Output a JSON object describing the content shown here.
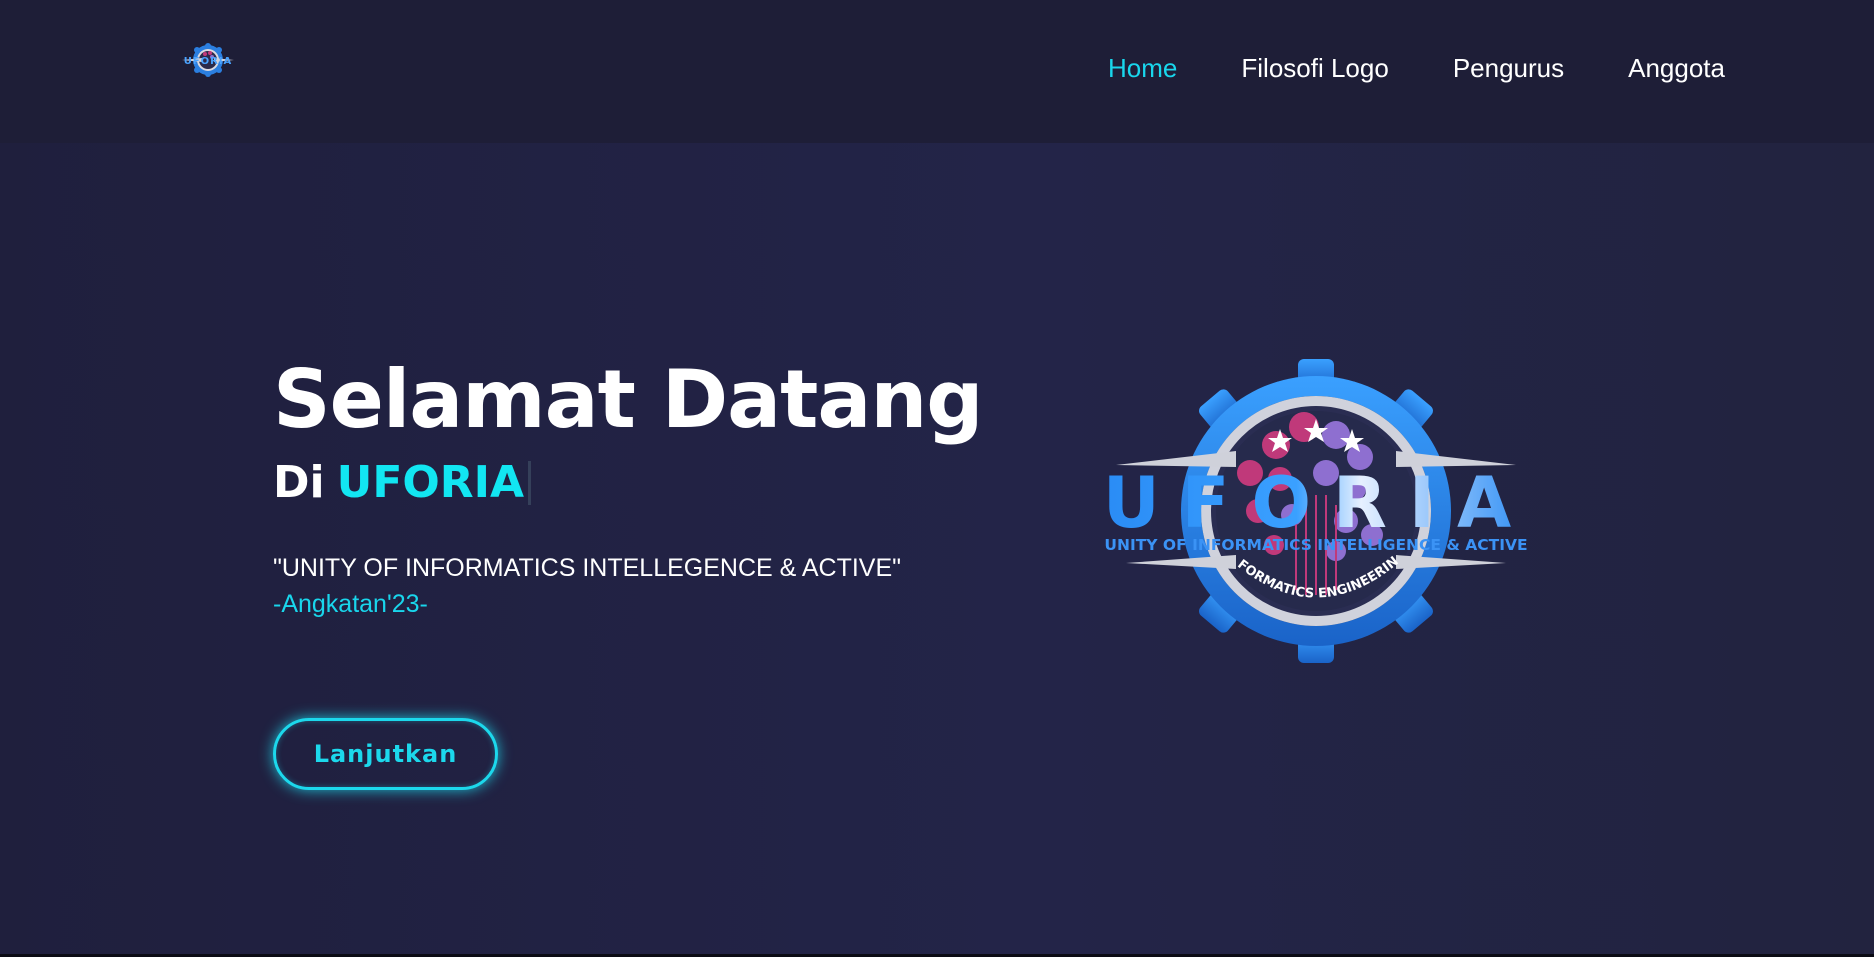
{
  "header": {
    "logo_text": "UFORIA",
    "nav": [
      {
        "label": "Home",
        "active": true
      },
      {
        "label": "Filosofi Logo",
        "active": false
      },
      {
        "label": "Pengurus",
        "active": false
      },
      {
        "label": "Anggota",
        "active": false
      }
    ]
  },
  "hero": {
    "title": "Selamat Datang",
    "sub_prefix": "Di",
    "sub_name": "UFORIA",
    "motto": "\"UNITY OF INFORMATICS INTELLEGENCE & ACTIVE\"",
    "batch": "-Angkatan'23-",
    "cta_label": "Lanjutkan"
  },
  "emblem": {
    "wordmark": "UFORIA",
    "tagline": "UNITY OF INFORMATICS INTELLIGENCE & ACTIVE",
    "arc_text": "INFORMATICS ENGINEERING"
  },
  "colors": {
    "accent": "#19d6ec",
    "background": "#212141",
    "header_bg": "#1e1e37",
    "emblem_blue": "#2b8ef0",
    "emblem_pink": "#c0397a",
    "emblem_purple": "#8e6fd0"
  }
}
